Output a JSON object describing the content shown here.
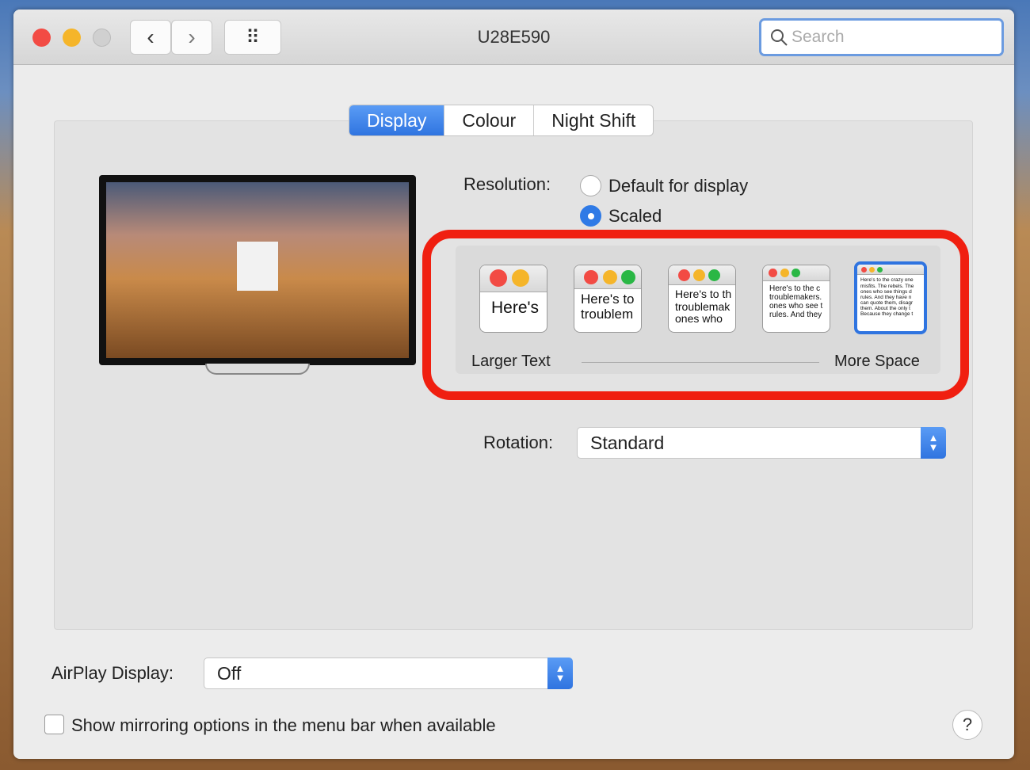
{
  "window": {
    "title": "U28E590"
  },
  "toolbar": {
    "back": "‹",
    "forward": "›",
    "grid": "⠿",
    "search_placeholder": "Search"
  },
  "tabs": [
    {
      "label": "Display",
      "active": true
    },
    {
      "label": "Colour",
      "active": false
    },
    {
      "label": "Night Shift",
      "active": false
    }
  ],
  "resolution": {
    "label": "Resolution:",
    "options": [
      {
        "label": "Default for display",
        "selected": false
      },
      {
        "label": "Scaled",
        "selected": true
      }
    ]
  },
  "scaling": {
    "left_label": "Larger Text",
    "right_label": "More Space",
    "selected_index": 4,
    "previews": [
      {
        "text": "Here's"
      },
      {
        "text": "Here's to\ntroublem"
      },
      {
        "text": "Here's to th\ntroublemak\nones who"
      },
      {
        "text": "Here's to the c\ntroublemakers.\nones who see t\nrules. And they"
      },
      {
        "text": "Here's to the crazy one\nmisfits. The rebels. The\nones who see things d\nrules. And they have n\ncan quote them, disagr\nthem. About the only t\nBecause they change t"
      }
    ]
  },
  "rotation": {
    "label": "Rotation:",
    "value": "Standard"
  },
  "airplay": {
    "label": "AirPlay Display:",
    "value": "Off"
  },
  "mirroring": {
    "label": "Show mirroring options in the menu bar when available",
    "checked": false
  },
  "help": "?",
  "colors": {
    "accent": "#2f74e0",
    "highlight": "#f01f10",
    "close": "#f24b44",
    "minimize": "#f5b52a",
    "zoom": "#2ab745"
  }
}
